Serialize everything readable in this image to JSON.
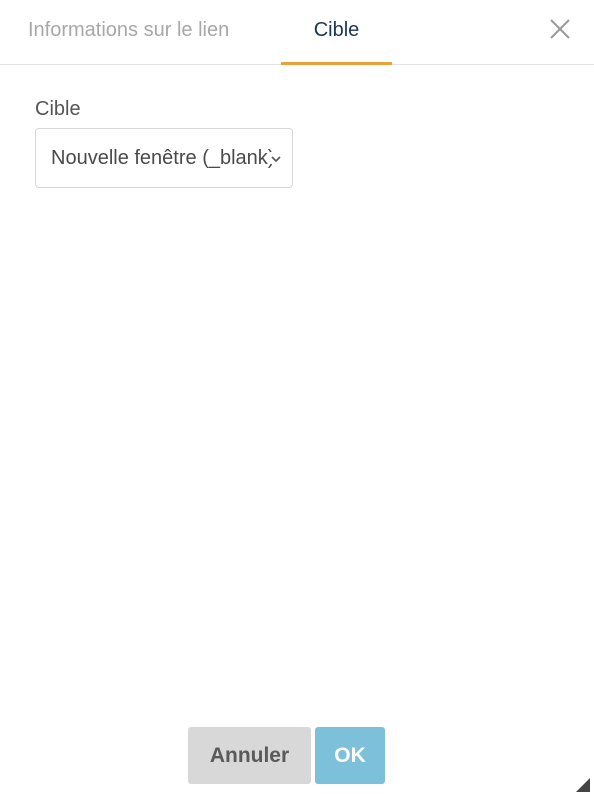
{
  "tabs": [
    {
      "label": "Informations sur le lien",
      "active": false
    },
    {
      "label": "Cible",
      "active": true
    }
  ],
  "form": {
    "target_label": "Cible",
    "target_value": "Nouvelle fenêtre (_blank)"
  },
  "footer": {
    "cancel_label": "Annuler",
    "ok_label": "OK"
  },
  "icons": {
    "close": "close-icon",
    "dropdown": "chevron-down-icon",
    "resize": "resize-handle-icon"
  },
  "colors": {
    "active_tab_text": "#1d3557",
    "active_tab_underline": "#e9a23b",
    "inactive_tab_text": "#a8a8a8",
    "ok_button": "#7cc0da",
    "cancel_button": "#d8d8d8"
  }
}
